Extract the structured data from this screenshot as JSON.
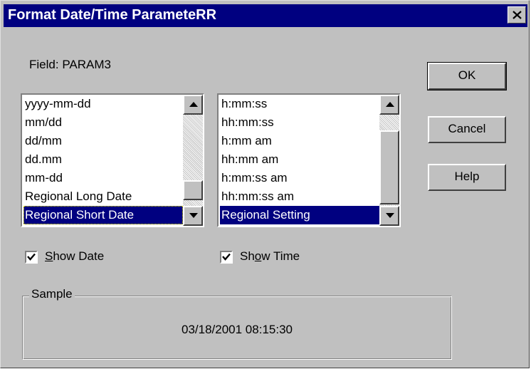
{
  "window": {
    "title": "Format Date/Time ParameteRR"
  },
  "field": {
    "label": "Field:",
    "value": "PARAM3"
  },
  "date_list": {
    "items": [
      "yyyy-mm-dd",
      "mm/dd",
      "dd/mm",
      "dd.mm",
      "mm-dd",
      "Regional Long Date",
      "Regional Short Date"
    ],
    "selected": "Regional Short Date"
  },
  "time_list": {
    "items": [
      "h:mm:ss",
      "hh:mm:ss",
      "h:mm am",
      "hh:mm am",
      "h:mm:ss am",
      "hh:mm:ss am",
      "Regional Setting"
    ],
    "selected": "Regional Setting"
  },
  "checkboxes": {
    "show_date": {
      "label_prefix": "",
      "mnemonic": "S",
      "label_rest": "how Date",
      "checked": true
    },
    "show_time": {
      "label_prefix": "Sh",
      "mnemonic": "o",
      "label_rest": "w Time",
      "checked": true
    }
  },
  "buttons": {
    "ok": "OK",
    "cancel": "Cancel",
    "help": "Help"
  },
  "sample": {
    "legend": "Sample",
    "value": "03/18/2001 08:15:30"
  }
}
